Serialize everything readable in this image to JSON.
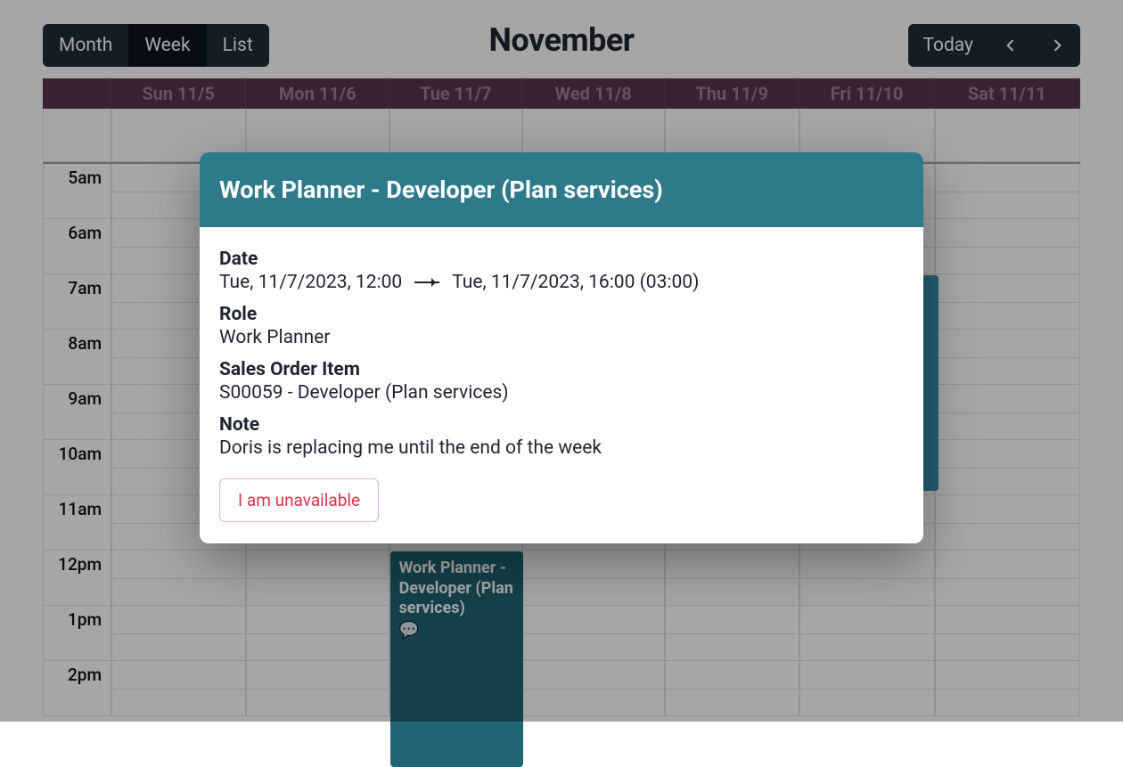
{
  "toolbar": {
    "views": [
      "Month",
      "Week",
      "List"
    ],
    "active_view": "Week",
    "title": "November",
    "today_label": "Today"
  },
  "calendar": {
    "day_headers": [
      "",
      "Sun 11/5",
      "Mon 11/6",
      "Tue 11/7",
      "Wed 11/8",
      "Thu 11/9",
      "Fri 11/10",
      "Sat 11/11"
    ],
    "hours": [
      "5am",
      "6am",
      "7am",
      "8am",
      "9am",
      "10am",
      "11am",
      "12pm",
      "1pm",
      "2pm"
    ],
    "events": [
      {
        "id": "ev1",
        "day_index": 3,
        "title": "Work Planner - Developer (Plan services)",
        "has_note_icon": true,
        "speech_icon": "💬",
        "start_hour_index": 7,
        "duration_hours": 4
      },
      {
        "id": "ev2",
        "day_index": 6,
        "title": "",
        "has_note_icon": false,
        "accent": true,
        "start_hour_index": 2,
        "duration_hours": 4
      }
    ]
  },
  "modal": {
    "title": "Work Planner - Developer (Plan services)",
    "labels": {
      "date": "Date",
      "role": "Role",
      "sales_order_item": "Sales Order Item",
      "note": "Note"
    },
    "date_from": "Tue, 11/7/2023, 12:00",
    "date_to": "Tue, 11/7/2023, 16:00 (03:00)",
    "role_value": "Work Planner",
    "soi_value": "S00059 - Developer (Plan services)",
    "note_value": "Doris is replacing me until the end of the week",
    "unavailable_label": "I am unavailable"
  }
}
